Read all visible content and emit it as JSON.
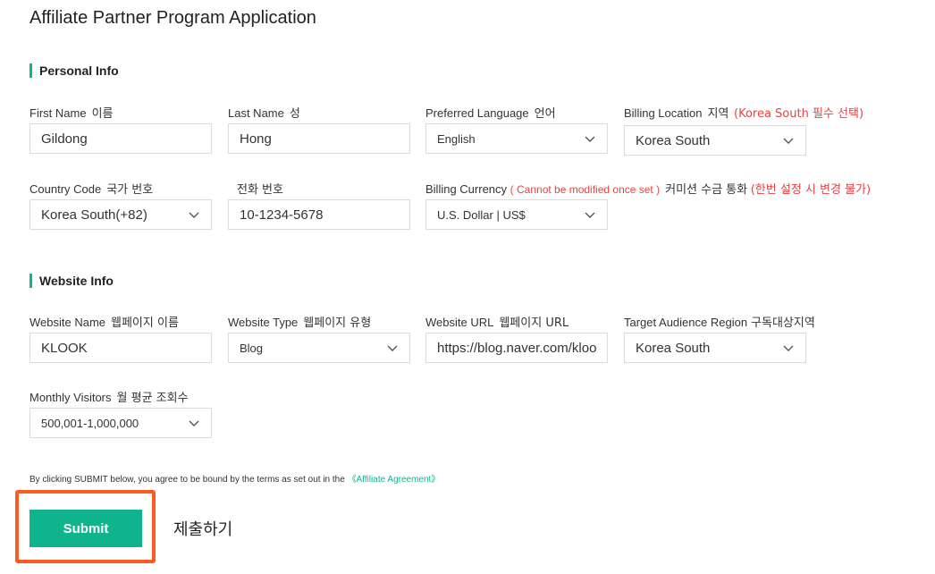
{
  "page": {
    "title": "Affiliate Partner Program Application"
  },
  "personal": {
    "section_title": "Personal Info",
    "first_name": {
      "label": "First Name",
      "label_ko": "이름",
      "value": "Gildong"
    },
    "last_name": {
      "label": "Last Name",
      "label_ko": "성",
      "value": "Hong"
    },
    "language": {
      "label": "Preferred Language",
      "label_ko": "언어",
      "value": "English"
    },
    "billing_location": {
      "label": "Billing Location",
      "label_ko": "지역",
      "note": "(Korea South 필수 선택)",
      "value": "Korea South"
    },
    "country_code": {
      "label": "Country Code",
      "label_ko": "국가 번호",
      "value": "Korea South(+82)"
    },
    "phone": {
      "label_ko": "전화 번호",
      "value": "10-1234-5678"
    },
    "currency": {
      "label": "Billing Currency",
      "note_en": "( Cannot be modified once set )",
      "label_ko": "커미션 수금 통화",
      "note_ko": "(한번 설정 시 변경 불가)",
      "value": "U.S. Dollar | US$"
    }
  },
  "website": {
    "section_title": "Website Info",
    "name": {
      "label": "Website Name",
      "label_ko": "웹페이지 이름",
      "value": "KLOOK"
    },
    "type": {
      "label": "Website Type",
      "label_ko": "웹페이지 유형",
      "value": "Blog"
    },
    "url": {
      "label": "Website URL",
      "label_ko": "웹페이지 URL",
      "value": "https://blog.naver.com/kloo"
    },
    "region": {
      "label": "Target Audience Region",
      "label_ko": "구독대상지역",
      "value": "Korea South"
    },
    "visitors": {
      "label": "Monthly Visitors",
      "label_ko": "월 평균 조회수",
      "value": "500,001-1,000,000"
    }
  },
  "terms": {
    "text": "By clicking SUBMIT below, you agree to be bound by the terms as set out in the ",
    "link": "《Affiliate Agreement》"
  },
  "submit": {
    "label": "Submit",
    "note": "제출하기"
  },
  "colors": {
    "accent": "#10b48c",
    "highlight": "#ff5a1f",
    "note_red": "#e54545"
  }
}
